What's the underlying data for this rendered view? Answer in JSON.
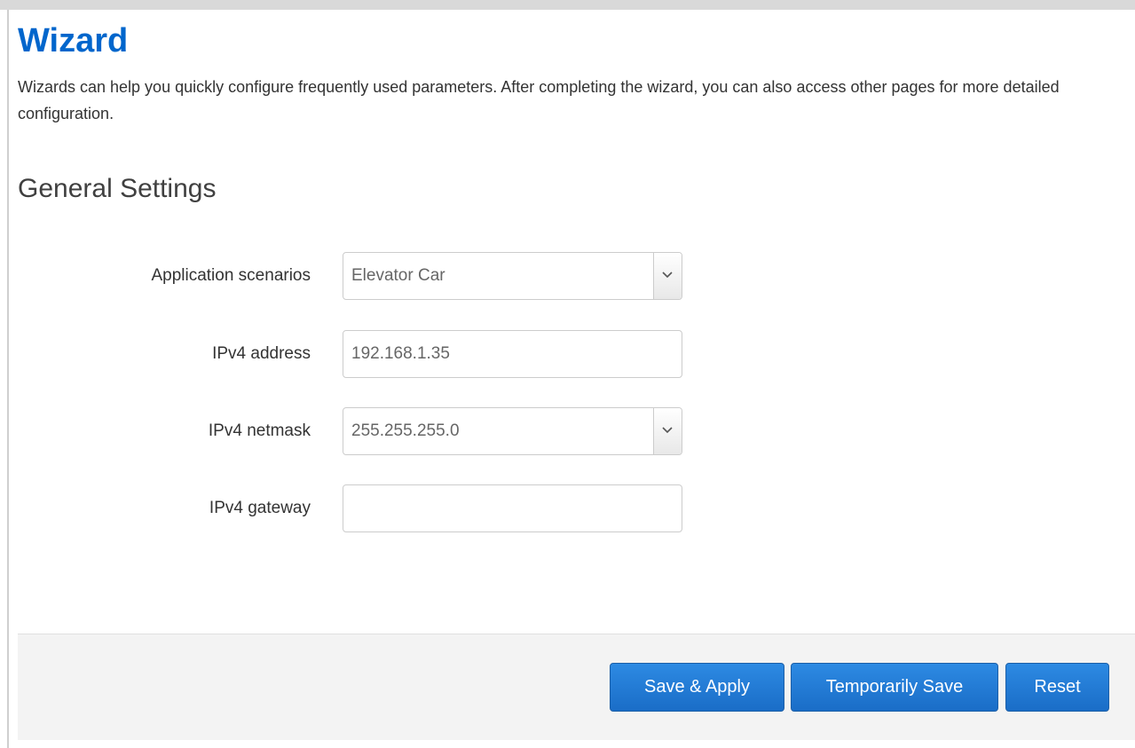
{
  "page": {
    "title": "Wizard",
    "description": "Wizards can help you quickly configure frequently used parameters. After completing the wizard, you can also access other pages for more detailed configuration."
  },
  "section": {
    "title": "General Settings"
  },
  "form": {
    "application_scenarios": {
      "label": "Application scenarios",
      "value": "Elevator Car"
    },
    "ipv4_address": {
      "label": "IPv4 address",
      "value": "192.168.1.35"
    },
    "ipv4_netmask": {
      "label": "IPv4 netmask",
      "value": "255.255.255.0"
    },
    "ipv4_gateway": {
      "label": "IPv4 gateway",
      "value": ""
    }
  },
  "footer": {
    "save_apply_label": "Save & Apply",
    "temp_save_label": "Temporarily Save",
    "reset_label": "Reset"
  },
  "colors": {
    "title": "#0066cc",
    "button": "#1a6dc7"
  }
}
